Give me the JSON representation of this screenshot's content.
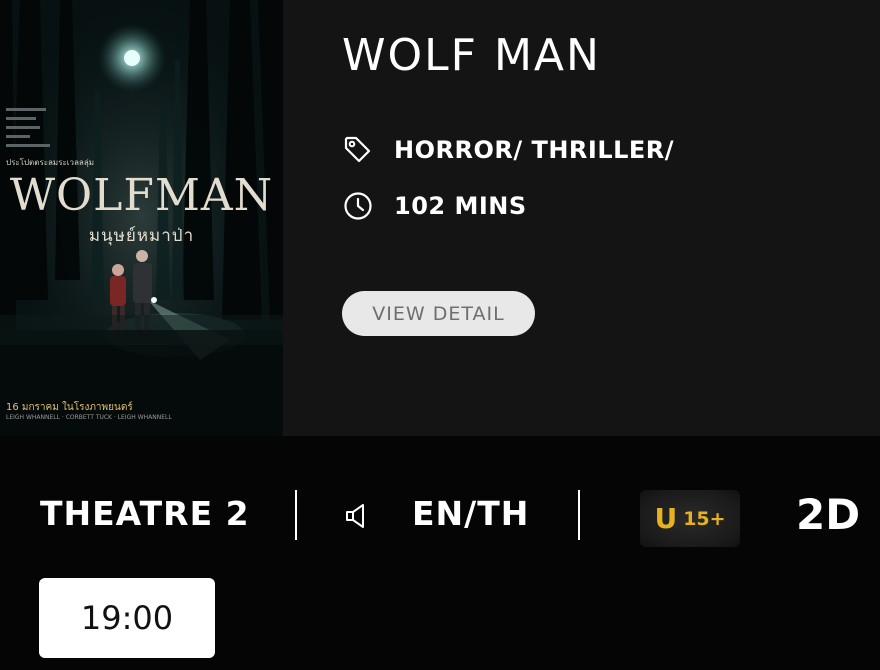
{
  "movie": {
    "title": "WOLF MAN",
    "genre": "HORROR/ THRILLER/",
    "duration": "102 MINS",
    "view_detail_label": "VIEW DETAIL",
    "genre_icon": "tag-icon",
    "duration_icon": "clock-icon",
    "poster": {
      "title": "WOLFMAN",
      "subtitle": "มนุษย์หมาป่า",
      "tagline": "ประโปตตระลมระเวลลลุ่ม",
      "release": "16 มกราคม ในโรงภาพยนตร์",
      "credits": "LEIGH WHANNELL · CORBETT TUCK · LEIGH WHANNELL"
    }
  },
  "showing": {
    "theatre": "THEATRE 2",
    "audio_icon": "speaker-icon",
    "language": "EN/TH",
    "rating_letter": "U",
    "rating_age": "15+",
    "format": "2D",
    "accent_color": "#e8b21f"
  },
  "showtimes": [
    {
      "time": "19:00"
    }
  ]
}
